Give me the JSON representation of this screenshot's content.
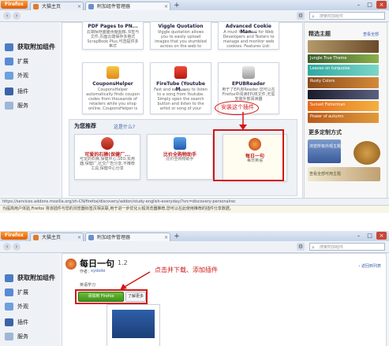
{
  "screens": [
    {
      "tabs": [
        "大猫主页",
        "附加组件管理器"
      ],
      "search_placeholder": "搜索附加组件",
      "sidebar": {
        "items": [
          "获取附加组件",
          "扩展",
          "外观",
          "插件",
          "服务"
        ]
      },
      "top_cards": [
        {
          "title": "PDF Pages to PN...",
          "desc": "云端保存面面贡献图像,书签与文件,页面云端保存多格式 ScrapBook Plus,可选提供多格式"
        },
        {
          "title": "Viggle Quotation",
          "desc": "Viggle quotation allows you to easily upload images that you stumbled across on the web to Viggle via a simple right click"
        },
        {
          "title": "Advanced Cookie Man...",
          "desc": "A must have tool for Web Developers and Testers to manage and monitor web cookies. Features List: Add/delete multi"
        }
      ],
      "mid_cards": [
        {
          "title": "CouponsHelper",
          "desc": "CouponsHelper automatically finds coupon codes from thousands of retailers while you shop online. CouponsHelper is"
        },
        {
          "title": "FireTube (Youtube M...",
          "desc": "Fast and easy way to listen to a song from Youtube. Simply open the search button and listen to the artist or song of your choice."
        },
        {
          "title": "EPUBReader",
          "desc": "用于了EPUBReader,您可以在Firefox中阅读EPUB文件,无需安装外部阅读器"
        }
      ],
      "recommend": {
        "heading": "为您推荐",
        "link": "这是什么?",
        "cards": [
          {
            "title": "可爱的石狮(保健厂...",
            "desc": "可爱的石狮,保健中心,SEO,实用器,保健厂,社交广告分享,不推荐工具,保健中心分享"
          },
          {
            "title": "比价全购物助手",
            "desc": "比价全购物助手"
          },
          {
            "title": "每日一句",
            "desc": "每日英语"
          }
        ]
      },
      "annotation": "安装这个插件",
      "right": {
        "heading": "精选主题",
        "see_all": "查看全部",
        "themes": [
          "Jungle True Theme",
          "Leaves on turquoise",
          "Rusty Colors",
          "Sunset Fisherman",
          "Power of autumn"
        ],
        "more_heading": "更多定制方式",
        "more_items": [
          "浏览所有外观主题",
          "查看全部可用主题"
        ]
      },
      "status_url": "https://services.addons.mozilla.org/zh-CN/firefox/discovery/addon/study-english-everyday/?src=discovery-personalrec",
      "info_bar": "为提高用户体验,Firefox 将该插件与您的浏览器标签页相关联,用于进一步优化火狐浏览器推荐,您可以在此使用推荐的插件分享数据。"
    },
    {
      "tabs": [
        "大猫主页",
        "附加组件管理器"
      ],
      "search_placeholder": "搜索附加组件",
      "sidebar": {
        "items": [
          "获取附加组件",
          "扩展",
          "外观",
          "插件",
          "服务"
        ]
      },
      "addon": {
        "title": "每日一句",
        "version": "1.2",
        "by_label": "作者：",
        "author": "xydode",
        "subtitle": "英语学习",
        "install_label": "添加到 Firefox",
        "more_label": "了解更多",
        "back_link": "返回到列表"
      },
      "annotation": "点击并下载、添加插件"
    }
  ],
  "colors": {
    "firefox_orange": "#e2681a",
    "annotation_red": "#d01818",
    "install_green": "#3f8f1c",
    "selected_bg": "#fffdf0"
  }
}
